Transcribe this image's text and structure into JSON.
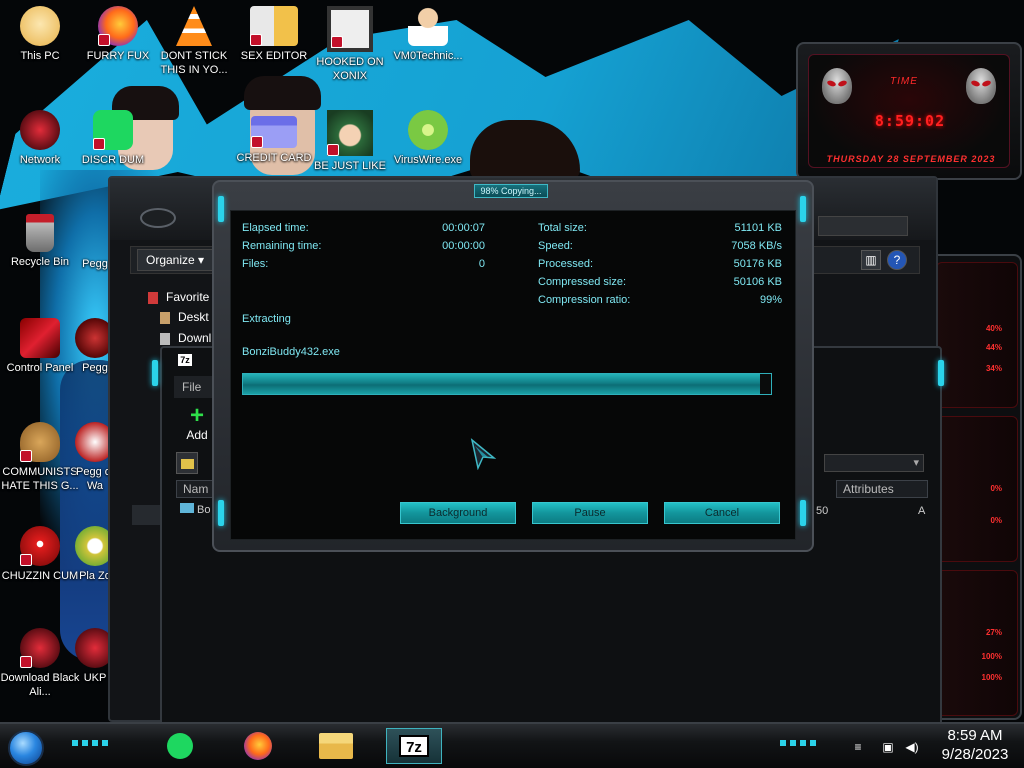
{
  "desktop": {
    "icons": [
      {
        "label": "This PC"
      },
      {
        "label": "FURRY FUX"
      },
      {
        "label": "DONT STICK THIS IN YO..."
      },
      {
        "label": "SEX EDITOR"
      },
      {
        "label": "HOOKED ON XONIX"
      },
      {
        "label": "VM0Technic..."
      },
      {
        "label": "Network"
      },
      {
        "label": "DISCR DUM"
      },
      {
        "label": "CREDIT CARD"
      },
      {
        "label": "BE JUST LIKE"
      },
      {
        "label": "VirusWire.exe"
      },
      {
        "label": "Recycle Bin"
      },
      {
        "label": "Pegg"
      },
      {
        "label": "Control Panel"
      },
      {
        "label": "Pegg"
      },
      {
        "label": "COMMUNISTS HATE THIS G..."
      },
      {
        "label": "Pegg of Wa"
      },
      {
        "label": "CHUZZIN CUM"
      },
      {
        "label": "Pla Zo"
      },
      {
        "label": "Download Black Ali..."
      },
      {
        "label": "UKP"
      }
    ]
  },
  "gadget": {
    "time_label": "TIME",
    "time": "8:59:02",
    "date": "THURSDAY 28 SEPTEMBER 2023",
    "percents": [
      "40%",
      "44%",
      "34%",
      "0%",
      "0%",
      "27%",
      "100%",
      "100%"
    ]
  },
  "explorer": {
    "organize": "Organize",
    "nav": [
      "Favorite",
      "Deskt",
      "Downl"
    ],
    "help_icon": "?"
  },
  "sevenzip_fm": {
    "badge": "7z",
    "menu": "File",
    "add_label": "Add",
    "col_name": "Nam",
    "col_attributes": "Attributes",
    "row_name": "Bo",
    "row_size": "50",
    "row_attr": "A"
  },
  "progress_dialog": {
    "title": "98% Copying...",
    "left_stats": [
      {
        "label": "Elapsed time:",
        "value": "00:00:07"
      },
      {
        "label": "Remaining time:",
        "value": "00:00:00"
      },
      {
        "label": "Files:",
        "value": "0"
      }
    ],
    "right_stats": [
      {
        "label": "Total size:",
        "value": "51101 KB"
      },
      {
        "label": "Speed:",
        "value": "7058 KB/s"
      },
      {
        "label": "Processed:",
        "value": "50176 KB"
      },
      {
        "label": "Compressed size:",
        "value": "50106 KB"
      },
      {
        "label": "Compression ratio:",
        "value": "99%"
      }
    ],
    "status": "Extracting",
    "file": "BonziBuddy432.exe",
    "progress_fraction": 0.98,
    "buttons": {
      "background": "Background",
      "pause": "Pause",
      "cancel": "Cancel"
    }
  },
  "taskbar": {
    "time": "8:59 AM",
    "date": "9/28/2023",
    "apps": [
      "spotify-icon",
      "firefox-icon",
      "file-explorer-icon",
      "7zip-icon"
    ],
    "active_app_label": "7z"
  },
  "colors": {
    "accent_cyan": "#2bd3ea",
    "dialog_text": "#7fe7f2",
    "widget_red": "#ff2020"
  }
}
